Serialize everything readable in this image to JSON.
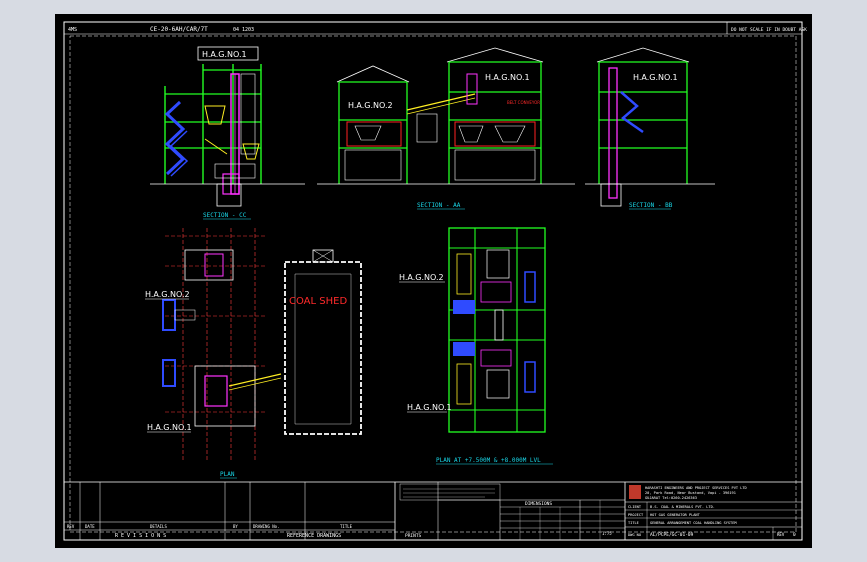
{
  "sheet": {
    "top_left_no": "4MS",
    "top_center_ref": "CE-20-6AH/CAR/7T",
    "top_center_sheet": "04 1203",
    "top_right_note": "DO NOT SCALE IF IN DOUBT ASK"
  },
  "labels": {
    "hag1_a": "H.A.G.NO.1",
    "hag2_b": "H.A.G.NO.2",
    "hag1_b": "H.A.G.NO.1",
    "hag1_c": "H.A.G.NO.1",
    "hag2_plan": "H.A.G.NO.2",
    "hag1_plan": "H.A.G.NO.1",
    "hag2_right": "H.A.G.NO.2",
    "hag1_right": "H.A.G.NO.1",
    "coal_shed": "COAL SHED",
    "section_cc": "SECTION - CC",
    "section_aa": "SECTION - AA",
    "section_bb": "SECTION - BB",
    "plan": "PLAN",
    "plan_levels": "PLAN AT +7.500M & +8.000M LVL"
  },
  "title_block": {
    "revisions_label": "R E V I S I O N S",
    "reference_drawings_label": "REFERENCE DRAWINGS",
    "prints_label": "PRINTS",
    "rev_col": "REV",
    "date_col": "DATE",
    "details_col": "DETAILS",
    "by_col": "BY",
    "drawing_no_col": "DRAWING No.",
    "title_col": "TITLE",
    "dimensions_label": "DIMENSIONS",
    "company_line1": "HARASHTI ENGINEERS AND PROJECT SERVICES PVT LTD",
    "company_line2": "20, Park Road, Near Bustand, Vapi - 396191",
    "company_line3": "GUJARAT  Tel:0260-2426363",
    "client_label": "CLIENT",
    "client_value": "B.S. COAL & MINERALS PVT. LTD.",
    "project_label": "PROJECT",
    "project_value": "HOT GAS GENERATOR PLANT",
    "title_label": "TITLE",
    "title_value": "GENERAL ARRANGEMENT COAL HANDLING SYSTEM",
    "dwg_no_label": "DWG NO",
    "dwg_no_value": "AL/PCPE/GC-01-09",
    "rev_label": "REV",
    "rev_value": "0",
    "scale_value": "1:75"
  }
}
